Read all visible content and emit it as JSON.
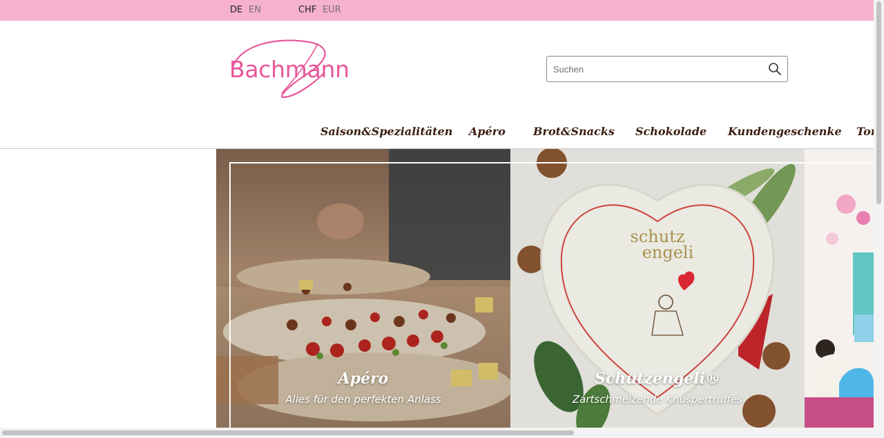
{
  "topbar": {
    "languages": [
      {
        "label": "DE",
        "active": true
      },
      {
        "label": "EN",
        "active": false
      }
    ],
    "currencies": [
      {
        "label": "CHF",
        "active": true
      },
      {
        "label": "EUR",
        "active": false
      }
    ],
    "background": "#f5b1ce"
  },
  "logo": {
    "text": "Bachmann",
    "color": "#e8569a"
  },
  "search": {
    "placeholder": "Suchen",
    "value": "",
    "icon": "search-icon"
  },
  "nav": {
    "items": [
      {
        "label": "Saison&Spezialitäten"
      },
      {
        "label": "Apéro"
      },
      {
        "label": "Brot&Snacks"
      },
      {
        "label": "Schokolade"
      },
      {
        "label": "Kundengeschenke"
      },
      {
        "label": "Tor"
      }
    ],
    "color": "#3b1d10"
  },
  "tiles": [
    {
      "title": "Apéro",
      "subtitle": "Alles für den perfekten Anlass"
    },
    {
      "title": "Schutzengeli®",
      "subtitle": "Zartschmelzende Knuspertruffes"
    },
    {
      "title": "",
      "subtitle": ""
    }
  ],
  "product_art": {
    "box_text_line1": "schutz",
    "box_text_line2": "engeli"
  }
}
